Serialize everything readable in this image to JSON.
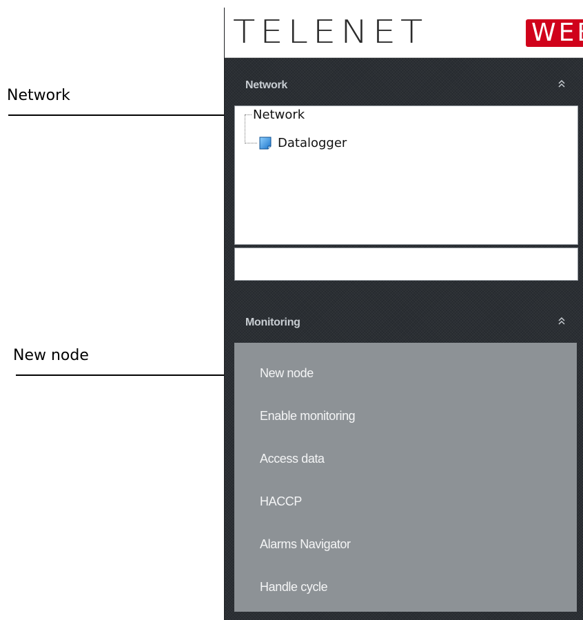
{
  "callouts": {
    "network": "Network",
    "new_node": "New node"
  },
  "logo": {
    "telenet": "TELENET",
    "web": "WEB"
  },
  "network_section": {
    "title": "Network",
    "collapse_icon": "double-chevron-up-icon",
    "tree": {
      "root": "Network",
      "child": "Datalogger",
      "child_icon": "datalogger-icon"
    },
    "input_value": ""
  },
  "monitoring_section": {
    "title": "Monitoring",
    "collapse_icon": "double-chevron-up-icon",
    "items": [
      "New node",
      "Enable monitoring",
      "Access data",
      "HACCP",
      "Alarms Navigator",
      "Handle cycle"
    ]
  },
  "colors": {
    "panel_bg": "#262a2f",
    "menu_bg": "#8d9296",
    "brand_red": "#d0021b"
  }
}
